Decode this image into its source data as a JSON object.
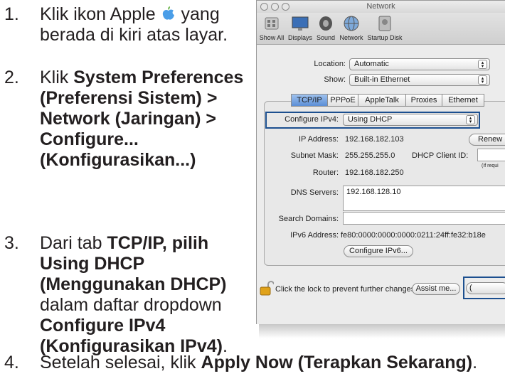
{
  "steps": [
    {
      "number": "1.",
      "parts": {
        "a": "Klik ikon Apple",
        "b": "yang berada di kiri atas layar."
      }
    },
    {
      "number": "2.",
      "parts": {
        "a": "Klik",
        "b": "System Preferences (Preferensi Sistem) > Network (Jaringan) > Configure... (Konfigurasikan...)"
      }
    },
    {
      "number": "3.",
      "parts": {
        "a": "Dari tab",
        "b": "TCP/IP, pilih Using DHCP (Menggunakan DHCP)",
        "c": "dalam daftar dropdown",
        "d": "Configure IPv4 (Konfigurasikan IPv4)",
        "e": "."
      }
    },
    {
      "number": "4.",
      "parts": {
        "a": "Setelah selesai, klik",
        "b": "Apply Now (Terapkan Sekarang)",
        "c": "."
      }
    }
  ],
  "window": {
    "title": "Network",
    "toolbar": [
      "Show All",
      "Displays",
      "Sound",
      "Network",
      "Startup Disk"
    ],
    "location_label": "Location:",
    "location_value": "Automatic",
    "show_label": "Show:",
    "show_value": "Built-in Ethernet",
    "tabs": [
      "TCP/IP",
      "PPPoE",
      "AppleTalk",
      "Proxies",
      "Ethernet"
    ],
    "configure_label": "Configure IPv4:",
    "configure_value": "Using DHCP",
    "ip_label": "IP Address:",
    "ip_value": "192.168.182.103",
    "renew_button": "Renew D",
    "subnet_label": "Subnet Mask:",
    "subnet_value": "255.255.255.0",
    "dhcp_client_label": "DHCP Client ID:",
    "dhcp_note": "(If requi",
    "router_label": "Router:",
    "router_value": "192.168.182.250",
    "dns_label": "DNS Servers:",
    "dns_value": "192.168.128.10",
    "search_label": "Search Domains:",
    "ipv6_label": "IPv6 Address:",
    "ipv6_value": "fe80:0000:0000:0000:0211:24ff:fe32:b18e",
    "configure_ipv6_button": "Configure IPv6...",
    "lock_text": "Click the lock to prevent further changes.",
    "assist_button": "Assist me...",
    "apply_button": "("
  },
  "colors": {
    "highlight": "#1c4f8f",
    "apple_icon": "#4a9ee8"
  }
}
